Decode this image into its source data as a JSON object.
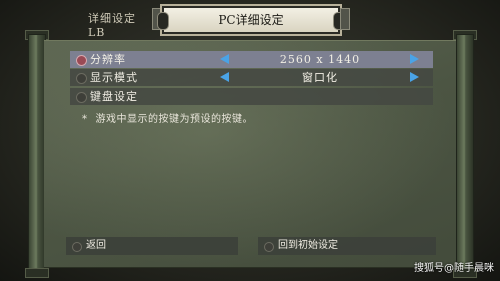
{
  "header": {
    "tab_detail_label": "详细设定 LB",
    "active_tab_label": "PC详细设定"
  },
  "settings": [
    {
      "label": "分辨率",
      "value": "2560  x  1440",
      "selected": true
    },
    {
      "label": "显示模式",
      "value": "窗口化",
      "selected": false
    },
    {
      "label": "键盘设定",
      "value": "",
      "selected": false
    }
  ],
  "note": {
    "star": "*",
    "text": "游戏中显示的按键为预设的按键。"
  },
  "buttons": {
    "back_label": "返回",
    "reset_label": "回到初始设定"
  },
  "watermark": "搜狐号@随手晨咪",
  "colors": {
    "selected_row": "#7d8091",
    "arrow": "#4aa3e6",
    "paper": "#4c5543"
  }
}
